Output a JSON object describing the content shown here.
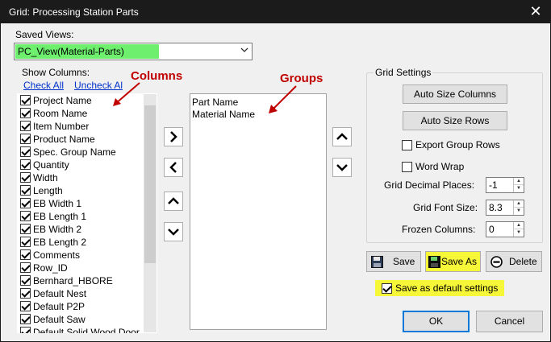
{
  "window": {
    "title": "Grid: Processing Station Parts",
    "close_glyph": "✕"
  },
  "saved_views": {
    "label": "Saved Views:",
    "selected": "PC_View(Material-Parts)",
    "highlight_color": "#6ef06e"
  },
  "show_columns": {
    "label": "Show Columns:",
    "check_all": "Check All",
    "uncheck_all": "Uncheck All",
    "items": [
      "Project Name",
      "Room Name",
      "Item Number",
      "Product Name",
      "Spec. Group Name",
      "Quantity",
      "Width",
      "Length",
      "EB Width 1",
      "EB Length 1",
      "EB Width 2",
      "EB Length 2",
      "Comments",
      "Row_ID",
      "Bernhard_HBORE",
      "Default Nest",
      "Default P2P",
      "Default Saw",
      "Default Solid Wood Door"
    ]
  },
  "groups": {
    "items": [
      "Part Name",
      "Material Name"
    ]
  },
  "annotations": {
    "columns": "Columns",
    "groups": "Groups",
    "color": "#c00000"
  },
  "grid_settings": {
    "title": "Grid Settings",
    "auto_size_columns": "Auto Size Columns",
    "auto_size_rows": "Auto Size Rows",
    "export_group_rows": "Export Group Rows",
    "word_wrap": "Word Wrap",
    "decimal_places_label": "Grid Decimal Places:",
    "decimal_places_value": "-1",
    "font_size_label": "Grid Font Size:",
    "font_size_value": "8.3",
    "frozen_columns_label": "Frozen Columns:",
    "frozen_columns_value": "0"
  },
  "actions": {
    "save": "Save",
    "save_as": "Save As",
    "delete": "Delete",
    "save_default": "Save as default settings",
    "ok": "OK",
    "cancel": "Cancel"
  },
  "colors": {
    "highlight_yellow": "#f7f73a",
    "ok_border": "#0078d7"
  }
}
